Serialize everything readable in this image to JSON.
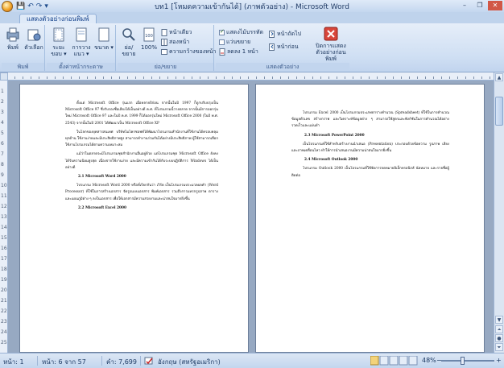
{
  "window": {
    "title": "บท1 [โหมดความเข้ากันได้] (ภาพตัวอย่าง) - Microsoft Word",
    "controls": [
      "–",
      "❐",
      "✕"
    ]
  },
  "quick_access": [
    "💾",
    "↶",
    "↷",
    "▾"
  ],
  "tabs": [
    {
      "label": "แสดงตัวอย่างก่อนพิมพ์",
      "active": true
    }
  ],
  "ribbon": {
    "groups": [
      {
        "label": "พิมพ์",
        "buttons": [
          "พิมพ์",
          "ตัวเลือก"
        ]
      },
      {
        "label": "ตั้งค่าหน้ากระดาษ",
        "buttons": [
          "ระยะขอบ ▾",
          "การวางแนว ▾",
          "ขนาด ▾"
        ]
      },
      {
        "label": "ย่อ/ขยาย",
        "buttons": [
          "ย่อ/ขยาย",
          "100%"
        ],
        "small": [
          "หน้าเดียว",
          "สองหน้า",
          "ความกว้างของหน้า"
        ]
      },
      {
        "label": "แสดงตัวอย่าง",
        "checks": [
          {
            "label": "แสดงไม้บรรทัด",
            "checked": true
          },
          {
            "label": "แว่นขยาย",
            "checked": false
          },
          {
            "label": "ลดลง 1 หน้า",
            "checked": false
          }
        ],
        "small": [
          "หน้าถัดไป",
          "หน้าก่อน"
        ],
        "close_label": "ปิดการแสดงตัวอย่างก่อนพิมพ์"
      }
    ]
  },
  "ruler": {
    "vertical_labels": [
      "1",
      "2",
      "3",
      "4",
      "5",
      "6",
      "7",
      "8",
      "9",
      "10",
      "11",
      "12",
      "13",
      "14",
      "15",
      "16",
      "17",
      "18",
      "19",
      "20",
      "21",
      "22",
      "23",
      "24",
      "25"
    ]
  },
  "pages": [
    {
      "paragraphs": [
        "ตั้งแต่ Microsoft Office รุ่นแรก เมื่อหลายปีก่อน จากนั้นในปี 1997 ก็ถูกปรับปรุงเป็น Microsoft Office 97 ซึ่งรับรองชื่อเสียงได้เป็นอย่างดี ค.ศ. ที่โปรแกรมนี้วางตลาด จากนั้นมีการออกรุ่นใหม่ Microsoft Office 97 และในปี ค.ศ. 1999 ก็ได้ออกรุ่นใหม่ Microsoft Office 2000 (ในปี พ.ศ. 2543) จากนั้นในปี 2001 ได้พัฒนาเป็น Microsoft Office XP",
        "ในโลกของยุคสารสนเทศ บริษัทไมโครซอฟท์ได้พัฒนาโปรแกรมสำนักงานที่ใช้งานได้ครอบคลุมทุกด้าน ใช้งานง่ายและมีประสิทธิภาพสูง สามารถทำงานร่วมกันได้อย่างมีประสิทธิภาพ ผู้ใช้สามารถเลือกใช้งานโปรแกรมได้ตามความเหมาะสม",
        "แม้ว่าในตลาดจะมีโปรแกรมชุดสำนักงานอื่นอยู่ด้วย แต่โปรแกรมชุด Microsoft Office ยังคงได้รับความนิยมสูงสุด เนื่องจากใช้งานง่าย และมีความเข้ากันได้กับระบบปฏิบัติการ Windows ได้เป็นอย่างดี"
      ],
      "headings": [
        "2.1 Microsoft Word 2000",
        "2.2 Microsoft Excel 2000"
      ],
      "paragraphs_2": [
        "โปรแกรม Microsoft Word 2000 หรือที่เรียกกันว่า เวิร์ด เป็นโปรแกรมประมวลผลคำ (Word Processor) ที่ใช้ในการสร้างเอกสาร จัดรูปแบบเอกสาร พิมพ์เอกสาร รวมถึงการแทรกรูปภาพ ตาราง และแผนภูมิต่าง ๆ ลงในเอกสาร เพื่อให้เอกสารมีความสวยงามและน่าสนใจมากยิ่งขึ้น"
      ]
    },
    {
      "paragraphs": [
        "โปรแกรม Excel 2000 เป็นโปรแกรมประเภทตารางคำนวณ (Spreadsheet) ที่ใช้ในการคำนวณข้อมูลตัวเลข สร้างกราฟ และวิเคราะห์ข้อมูลต่าง ๆ สามารถใช้สูตรและฟังก์ชันในการคำนวณได้อย่างรวดเร็วและแม่นยำ"
      ],
      "headings": [
        "2.3 Microsoft PowerPoint 2000",
        "2.4 Microsoft Outlook 2000"
      ],
      "paragraphs_2": [
        "เป็นโปรแกรมที่ใช้สำหรับสร้างงานนำเสนอ (Presentation) ประกอบด้วยข้อความ รูปภาพ เสียง และภาพเคลื่อนไหว ทำให้การนำเสนองานมีความน่าสนใจมากยิ่งขึ้น",
        "โปรแกรม Outlook 2000 เป็นโปรแกรมที่ใช้จัดการจดหมายอิเล็กทรอนิกส์ นัดหมาย และรายชื่อผู้ติดต่อ"
      ]
    }
  ],
  "statusbar": {
    "section": "หน้า: 1",
    "page": "หน้า: 6 จาก 57",
    "words": "คำ: 7,699",
    "language": "อังกฤษ (สหรัฐอเมริกา)",
    "zoom": "48%"
  }
}
